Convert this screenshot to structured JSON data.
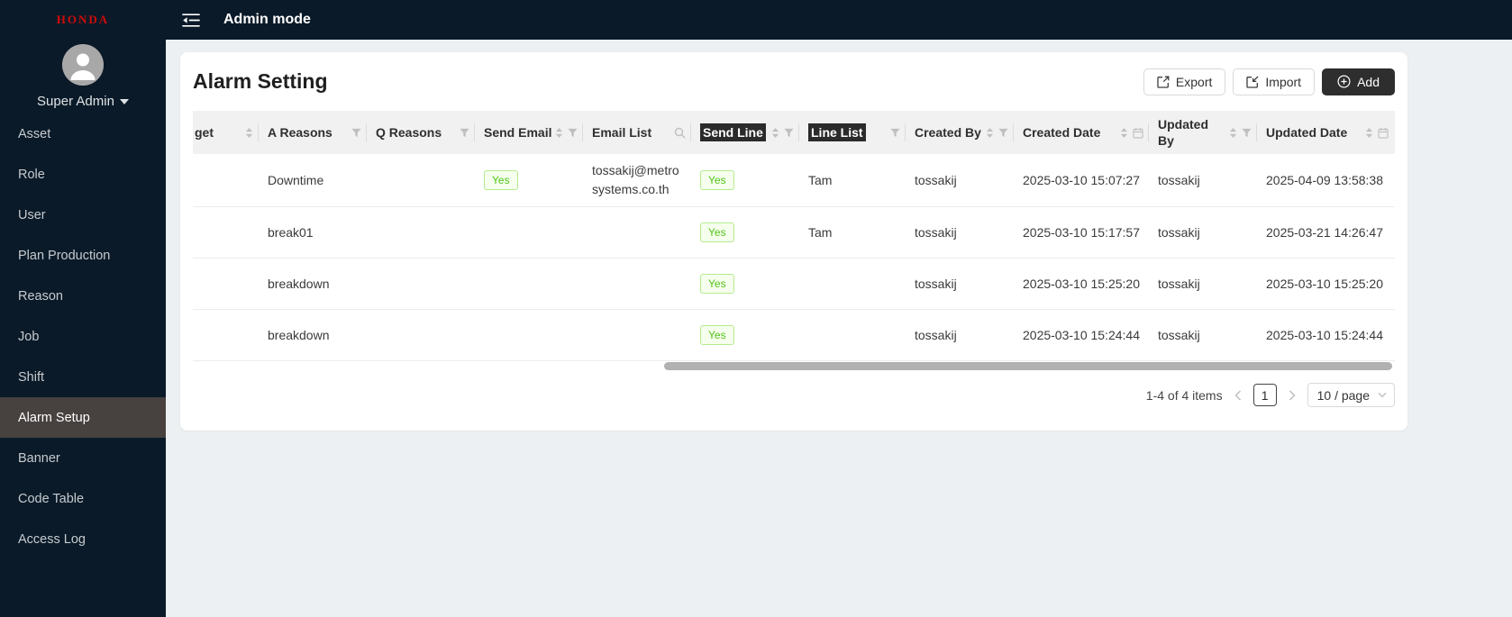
{
  "topbar": {
    "title": "Admin mode"
  },
  "sidebar": {
    "logo_text": "HONDA",
    "user_name": "Super Admin",
    "items": [
      {
        "id": "asset",
        "label": "Asset",
        "active": false
      },
      {
        "id": "role",
        "label": "Role",
        "active": false
      },
      {
        "id": "user",
        "label": "User",
        "active": false
      },
      {
        "id": "plan-production",
        "label": "Plan Production",
        "active": false
      },
      {
        "id": "reason",
        "label": "Reason",
        "active": false
      },
      {
        "id": "job",
        "label": "Job",
        "active": false
      },
      {
        "id": "shift",
        "label": "Shift",
        "active": false
      },
      {
        "id": "alarm-setup",
        "label": "Alarm Setup",
        "active": true
      },
      {
        "id": "banner",
        "label": "Banner",
        "active": false
      },
      {
        "id": "code-table",
        "label": "Code Table",
        "active": false
      },
      {
        "id": "access-log",
        "label": "Access Log",
        "active": false
      }
    ]
  },
  "page": {
    "title": "Alarm Setting",
    "export_label": "Export",
    "import_label": "Import",
    "add_label": "Add"
  },
  "table": {
    "columns": [
      {
        "key": "target",
        "label": "get",
        "icons": [
          "sort-icon"
        ],
        "highlighted": false
      },
      {
        "key": "a_reasons",
        "label": "A Reasons",
        "icons": [
          "filter-icon"
        ],
        "highlighted": false
      },
      {
        "key": "q_reasons",
        "label": "Q Reasons",
        "icons": [
          "filter-icon"
        ],
        "highlighted": false
      },
      {
        "key": "send_email",
        "label": "Send Email",
        "icons": [
          "sort-icon",
          "filter-icon"
        ],
        "highlighted": false
      },
      {
        "key": "email_list",
        "label": "Email List",
        "icons": [
          "search-icon"
        ],
        "highlighted": false
      },
      {
        "key": "send_line",
        "label": "Send Line",
        "icons": [
          "sort-icon",
          "filter-icon"
        ],
        "highlighted": true
      },
      {
        "key": "line_list",
        "label": "Line List",
        "icons": [
          "filter-icon"
        ],
        "highlighted": true
      },
      {
        "key": "created_by",
        "label": "Created By",
        "icons": [
          "sort-icon",
          "filter-icon"
        ],
        "highlighted": false
      },
      {
        "key": "created_date",
        "label": "Created Date",
        "icons": [
          "sort-icon",
          "calendar-icon"
        ],
        "highlighted": false
      },
      {
        "key": "updated_by",
        "label": "Updated By",
        "icons": [
          "sort-icon",
          "filter-icon"
        ],
        "highlighted": false
      },
      {
        "key": "updated_date",
        "label": "Updated Date",
        "icons": [
          "sort-icon",
          "calendar-icon"
        ],
        "highlighted": false
      }
    ],
    "badge_columns": [
      "send_email",
      "send_line"
    ],
    "rows": [
      {
        "target": "",
        "a_reasons": "Downtime",
        "q_reasons": "",
        "send_email": "Yes",
        "email_list": "tossakij@metrosystems.co.th",
        "send_line": "Yes",
        "line_list": "Tam",
        "created_by": "tossakij",
        "created_date": "2025-03-10 15:07:27",
        "updated_by": "tossakij",
        "updated_date": "2025-04-09 13:58:38"
      },
      {
        "target": "",
        "a_reasons": "break01",
        "q_reasons": "",
        "send_email": "",
        "email_list": "",
        "send_line": "Yes",
        "line_list": "Tam",
        "created_by": "tossakij",
        "created_date": "2025-03-10 15:17:57",
        "updated_by": "tossakij",
        "updated_date": "2025-03-21 14:26:47"
      },
      {
        "target": "",
        "a_reasons": "breakdown",
        "q_reasons": "",
        "send_email": "",
        "email_list": "",
        "send_line": "Yes",
        "line_list": "",
        "created_by": "tossakij",
        "created_date": "2025-03-10 15:25:20",
        "updated_by": "tossakij",
        "updated_date": "2025-03-10 15:25:20"
      },
      {
        "target": "",
        "a_reasons": "breakdown",
        "q_reasons": "",
        "send_email": "",
        "email_list": "",
        "send_line": "Yes",
        "line_list": "",
        "created_by": "tossakij",
        "created_date": "2025-03-10 15:24:44",
        "updated_by": "tossakij",
        "updated_date": "2025-03-10 15:24:44"
      }
    ]
  },
  "pagination": {
    "summary": "1-4 of 4 items",
    "current_page": "1",
    "page_size": "10 / page"
  },
  "colors": {
    "sidebar_bg": "#0a1a28",
    "sidebar_active_bg": "#474240",
    "honda_red": "#d20b0b",
    "tag_green_text": "#52c41a",
    "tag_green_bg": "#f6ffed",
    "tag_green_border": "#b7eb8f",
    "add_button_bg": "#2e2e2e",
    "header_selection_bg": "#2b2b2b",
    "table_header_bg": "#f1f1f1"
  }
}
